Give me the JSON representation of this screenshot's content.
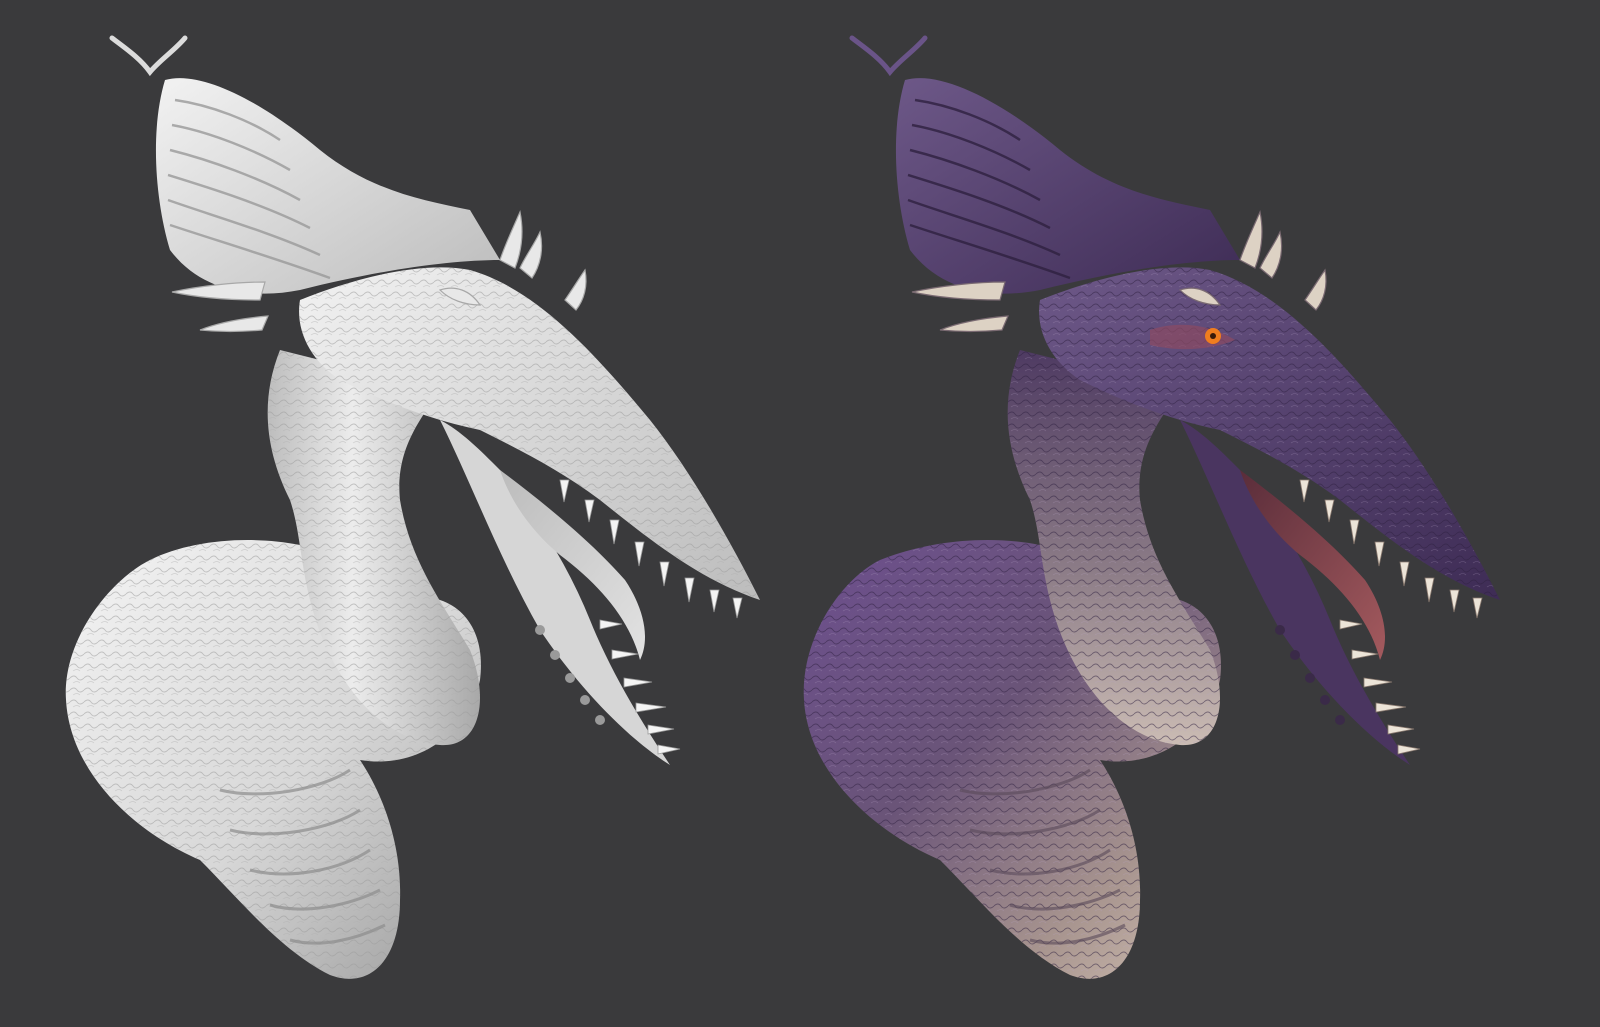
{
  "scene": {
    "background_color": "#3a3a3c",
    "render_count": 2
  },
  "renders": [
    {
      "id": "sculpt-untextured",
      "subject": "dragon-bust",
      "material": "clay",
      "base_color": "#e6e6e6",
      "shadow_color": "#8e8e8e",
      "highlight_color": "#f8f8f8"
    },
    {
      "id": "sculpt-painted",
      "subject": "dragon-bust",
      "material": "painted",
      "base_color": "#5b4472",
      "shadow_color": "#2f2140",
      "highlight_color": "#9e86b6",
      "belly_color": "#cbbcb4",
      "mouth_color": "#8c4a52",
      "eye_color": "#f07d1e",
      "tooth_color": "#ece4d8"
    }
  ]
}
